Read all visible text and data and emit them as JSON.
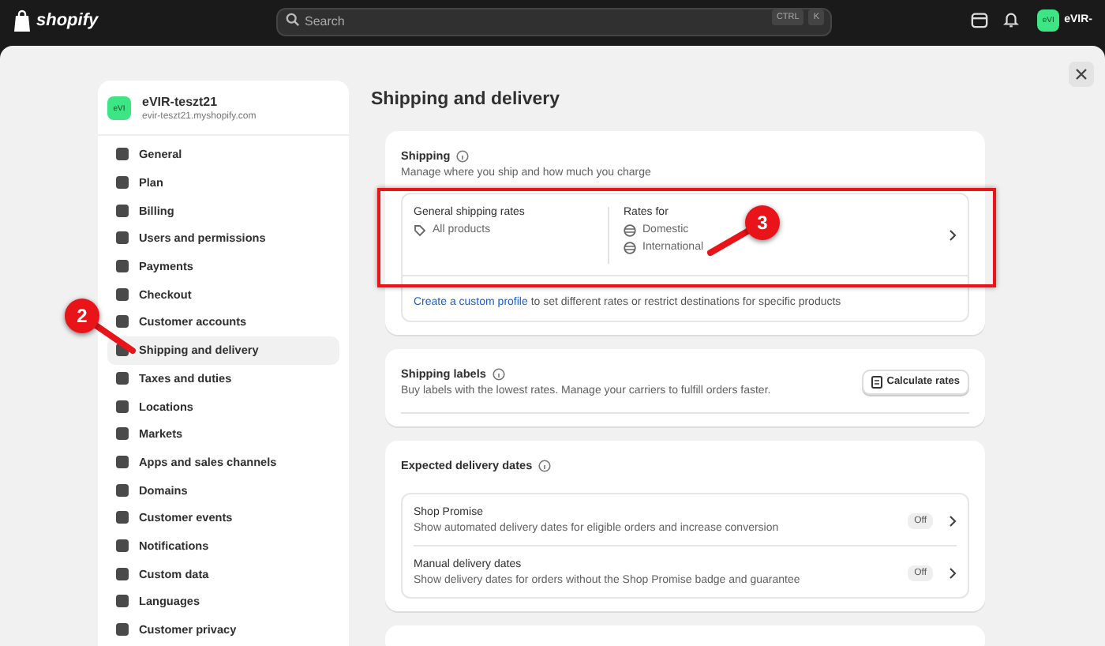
{
  "topbar": {
    "logo": "shopify",
    "search": {
      "placeholder": "Search"
    },
    "shortcut_keys": [
      "CTRL",
      "K"
    ],
    "account": {
      "initials": "eVI",
      "name": "eVIR-"
    }
  },
  "sidebar": {
    "store": {
      "initials": "eVI",
      "name": "eVIR-teszt21",
      "domain": "evir-teszt21.myshopify.com"
    },
    "items": [
      {
        "label": "General",
        "selected": false
      },
      {
        "label": "Plan",
        "selected": false
      },
      {
        "label": "Billing",
        "selected": false
      },
      {
        "label": "Users and permissions",
        "selected": false
      },
      {
        "label": "Payments",
        "selected": false
      },
      {
        "label": "Checkout",
        "selected": false
      },
      {
        "label": "Customer accounts",
        "selected": false
      },
      {
        "label": "Shipping and delivery",
        "selected": true
      },
      {
        "label": "Taxes and duties",
        "selected": false
      },
      {
        "label": "Locations",
        "selected": false
      },
      {
        "label": "Markets",
        "selected": false
      },
      {
        "label": "Apps and sales channels",
        "selected": false
      },
      {
        "label": "Domains",
        "selected": false
      },
      {
        "label": "Customer events",
        "selected": false
      },
      {
        "label": "Notifications",
        "selected": false
      },
      {
        "label": "Custom data",
        "selected": false
      },
      {
        "label": "Languages",
        "selected": false
      },
      {
        "label": "Customer privacy",
        "selected": false
      }
    ]
  },
  "main": {
    "title": "Shipping and delivery",
    "shipping": {
      "heading": "Shipping",
      "description": "Manage where you ship and how much you charge",
      "profile": {
        "title": "General shipping rates",
        "products": "All products",
        "rates_heading": "Rates for",
        "zones": [
          "Domestic",
          "International"
        ]
      },
      "footer": {
        "link": "Create a custom profile",
        "text": "to set different rates or restrict destinations for specific products"
      }
    },
    "labels": {
      "heading": "Shipping labels",
      "description": "Buy labels with the lowest rates. Manage your carriers to fulfill orders faster.",
      "button": "Calculate rates"
    },
    "delivery_dates": {
      "heading": "Expected delivery dates",
      "options": [
        {
          "title": "Shop Promise",
          "description": "Show automated delivery dates for eligible orders and increase conversion",
          "status": "Off"
        },
        {
          "title": "Manual delivery dates",
          "description": "Show delivery dates for orders without the Shop Promise badge and guarantee",
          "status": "Off"
        }
      ]
    }
  },
  "annotations": [
    {
      "number": "2"
    },
    {
      "number": "3"
    }
  ]
}
